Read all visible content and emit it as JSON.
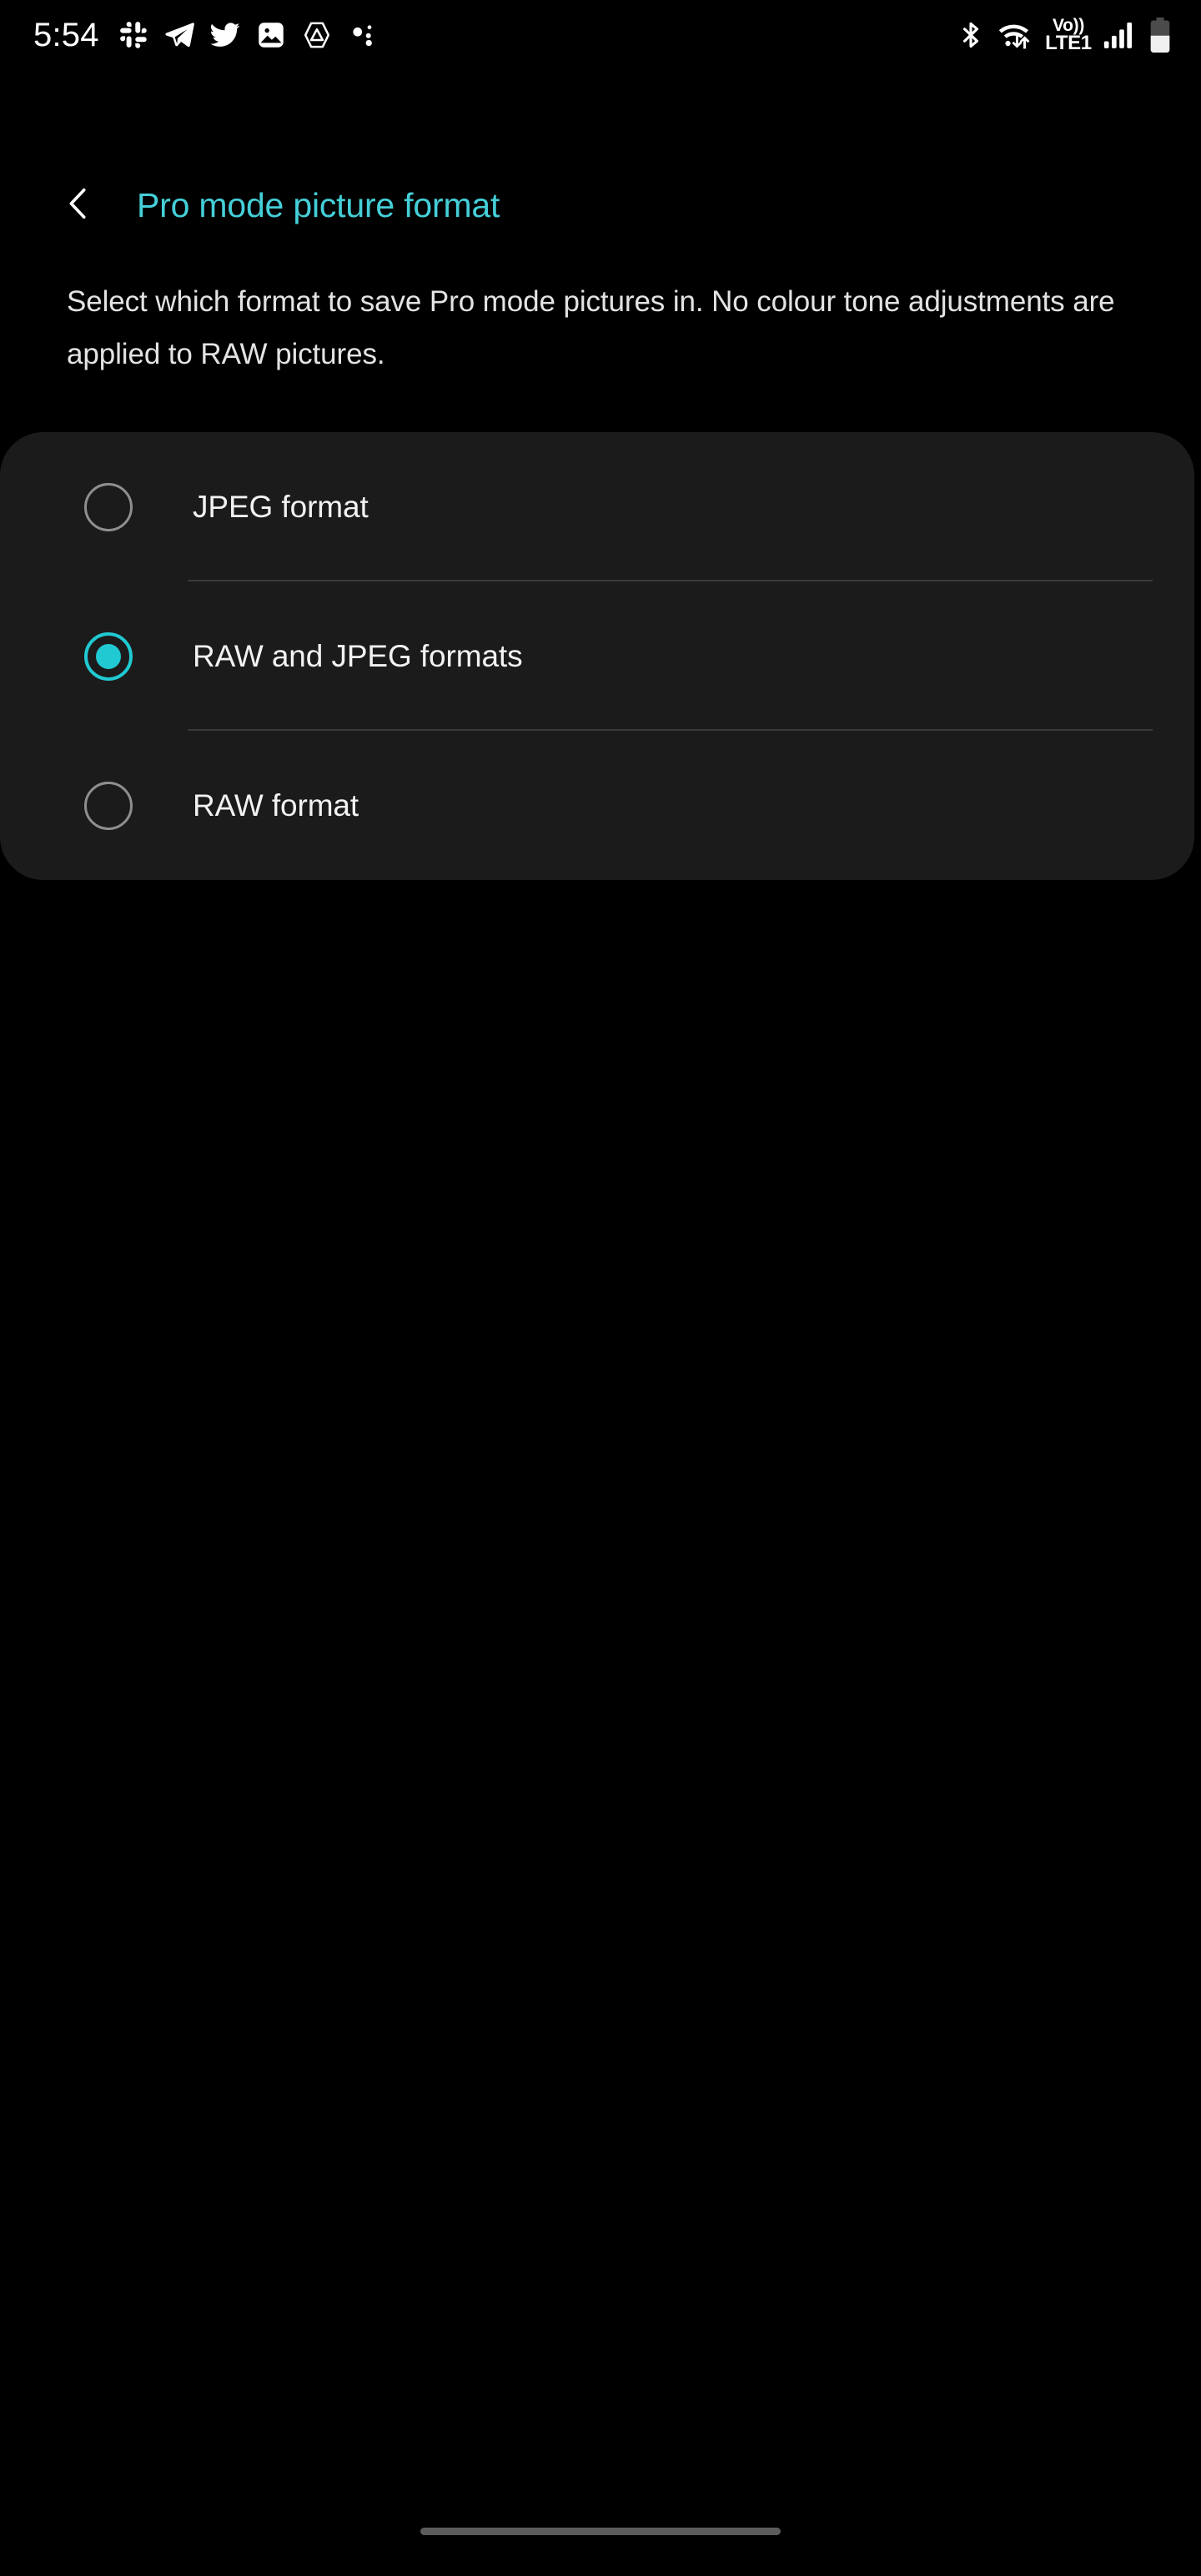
{
  "status_bar": {
    "time": "5:54",
    "left_icons": [
      {
        "name": "slack-icon"
      },
      {
        "name": "telegram-icon"
      },
      {
        "name": "twitter-icon"
      },
      {
        "name": "gallery-icon"
      },
      {
        "name": "affinity-triangle-icon"
      },
      {
        "name": "dots-icon"
      }
    ],
    "right_icons": [
      {
        "name": "bluetooth-icon"
      },
      {
        "name": "wifi-icon"
      }
    ],
    "volte_top": "Vo))",
    "volte_bottom": "LTE1",
    "signal": "signal-bars-icon",
    "battery": "battery-icon",
    "battery_level_percent": 48
  },
  "header": {
    "back_icon": "chevron-left-icon",
    "title": "Pro mode picture format",
    "title_color": "#45CFD8"
  },
  "description": "Select which format to save Pro mode pictures in. No colour tone adjustments are applied to RAW pictures.",
  "options": {
    "accent_color": "#21c9d2",
    "selected_index": 1,
    "items": [
      {
        "label": "JPEG format",
        "selected": false
      },
      {
        "label": "RAW and JPEG formats",
        "selected": true
      },
      {
        "label": "RAW format",
        "selected": false
      }
    ]
  },
  "nav_bar": {
    "home_indicator": "home-indicator"
  }
}
